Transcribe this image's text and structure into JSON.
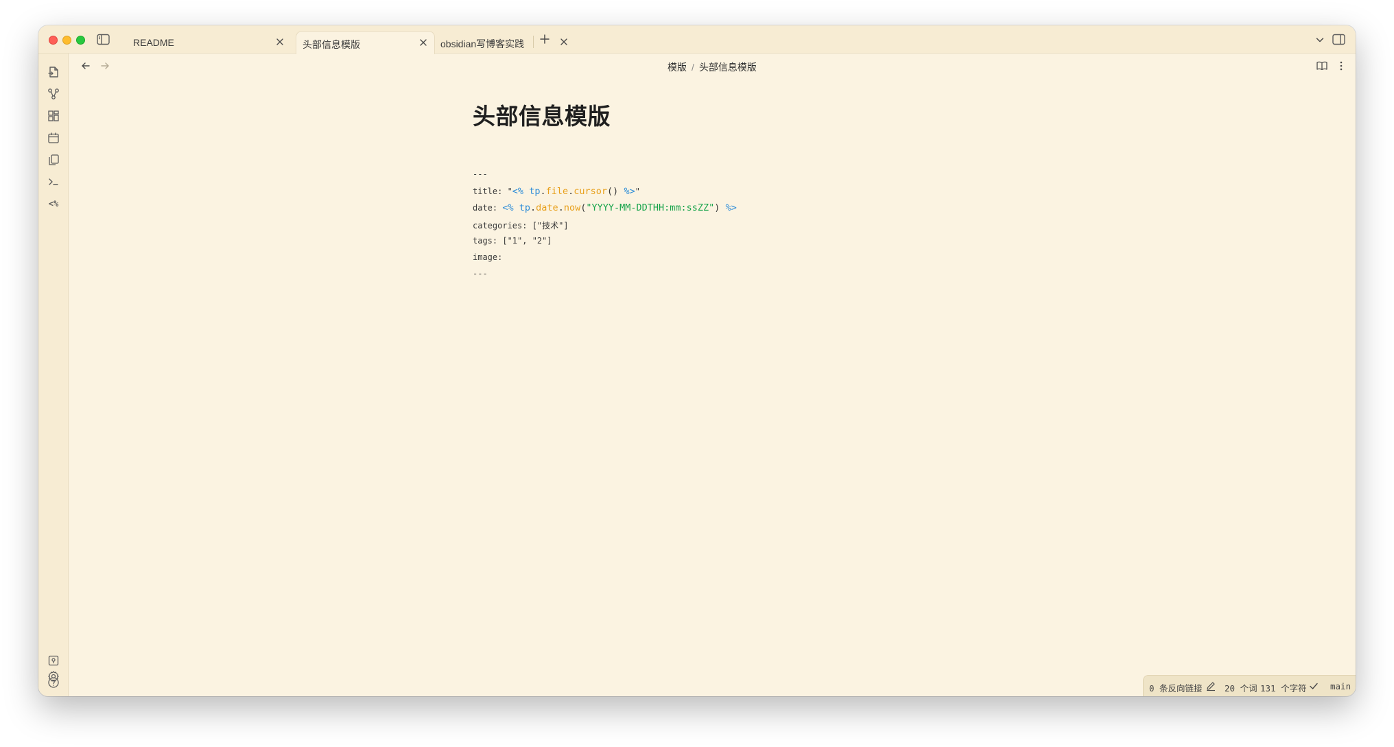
{
  "tabs": [
    {
      "label": "README",
      "active": false
    },
    {
      "label": "头部信息模版",
      "active": true
    },
    {
      "label": "obsidian写博客实践",
      "active": false
    }
  ],
  "breadcrumb": {
    "folder": "模版",
    "separator": "/",
    "file": "头部信息模版"
  },
  "note": {
    "title": "头部信息模版",
    "fence_open": "---",
    "fence_close": "---",
    "line_title": {
      "key": "title: \"",
      "open": "<%",
      "obj": "tp",
      "dot1": ".",
      "prop": "file",
      "dot2": ".",
      "fn": "cursor",
      "args": "()",
      "close": "%>",
      "end": "\""
    },
    "line_date": {
      "key": "date: ",
      "open": "<%",
      "obj": "tp",
      "dot1": ".",
      "prop": "date",
      "dot2": ".",
      "fn": "now",
      "paren_open": "(",
      "str": "\"YYYY-MM-DDTHH:mm:ssZZ\"",
      "paren_close": ")",
      "close": "%>"
    },
    "line_categories": "categories: [\"技术\"]",
    "line_tags": "tags: [\"1\", \"2\"]",
    "line_image": "image:"
  },
  "ribbon": {
    "templater_label": "<%"
  },
  "status": {
    "backlinks": "0 条反向链接",
    "words": "20 个词",
    "chars": "131 个字符",
    "branch": "main"
  },
  "colors": {
    "background": "#fbf3e1",
    "chrome": "#f7ecd3",
    "accent_blue": "#2e8dd8",
    "accent_orange": "#e8a01c",
    "accent_green": "#16a34a"
  },
  "icons": [
    "sidebar-toggle-icon",
    "close-icon",
    "plus-icon",
    "chevron-down-icon",
    "right-sidebar-toggle-icon",
    "open-file-icon",
    "graph-icon",
    "canvas-icon",
    "calendar-icon",
    "copy-icon",
    "terminal-icon",
    "vault-icon",
    "help-icon",
    "gear-icon",
    "arrow-left-icon",
    "arrow-right-icon",
    "book-open-icon",
    "more-vertical-icon",
    "pencil-icon",
    "check-icon"
  ]
}
